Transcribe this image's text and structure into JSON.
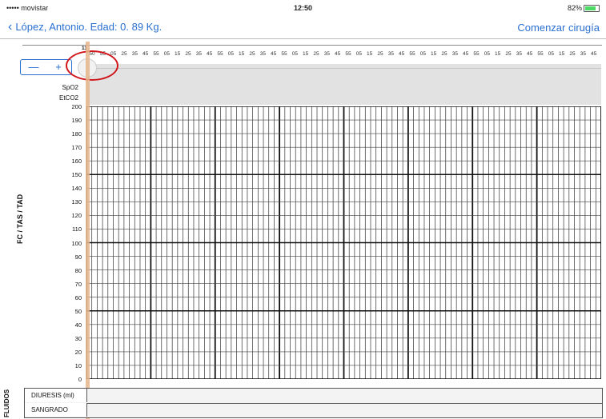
{
  "status_bar": {
    "carrier": "••••• movistar",
    "time": "12:50",
    "battery": "82%",
    "battery_level": 0.82
  },
  "nav": {
    "back_label": "López, Antonio. Edad: 0. 89 Kg.",
    "right_action": "Comenzar cirugía"
  },
  "controls": {
    "minus_label": "—",
    "plus_label": "+"
  },
  "timeline": {
    "hour": "11",
    "minutes": [
      "50",
      "55",
      "05",
      "25",
      "35",
      "45",
      "55",
      "05",
      "15",
      "25",
      "35",
      "45",
      "55",
      "05",
      "15",
      "25",
      "35",
      "45",
      "55",
      "05",
      "15",
      "25",
      "35",
      "45",
      "55",
      "05",
      "15",
      "25",
      "35",
      "45",
      "55",
      "05",
      "15",
      "25",
      "35",
      "45",
      "55",
      "05",
      "15",
      "25",
      "35",
      "45",
      "55",
      "05",
      "15",
      "25",
      "35",
      "45"
    ]
  },
  "row_labels": {
    "spo2": "SpO2",
    "etco2": "EtCO2"
  },
  "chart": {
    "y_axis_title": "FC / TAS / TAD",
    "y_ticks": [
      "200",
      "190",
      "180",
      "170",
      "160",
      "150",
      "140",
      "130",
      "120",
      "110",
      "100",
      "90",
      "80",
      "70",
      "60",
      "50",
      "40",
      "30",
      "20",
      "10",
      "0"
    ]
  },
  "fluids": {
    "title": "FLUIDOS",
    "rows": [
      "DIURESIS (ml)",
      "SANGRADO"
    ]
  },
  "colors": {
    "accent": "#2a6fd0",
    "annotation": "#d0161b",
    "time_marker": "#e5b58a"
  }
}
